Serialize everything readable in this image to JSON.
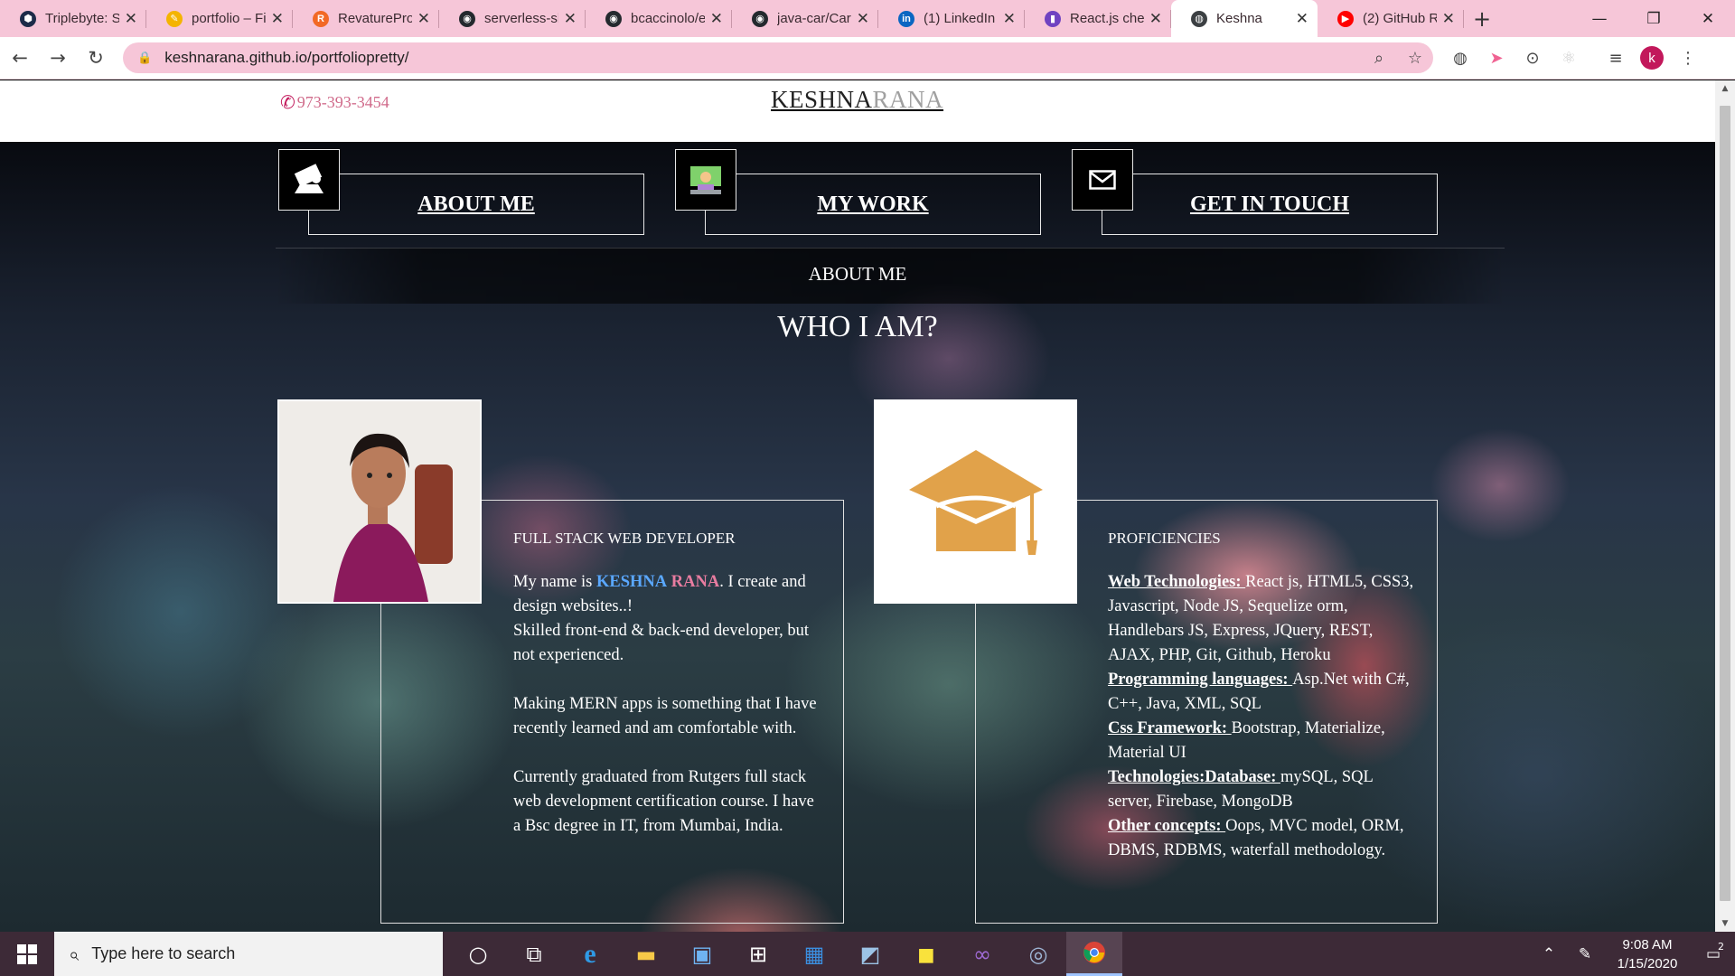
{
  "browser": {
    "tabs": [
      {
        "title": "Triplebyte: S",
        "fav_color": "#1d2b49",
        "fav_glyph": "⬢",
        "active": false
      },
      {
        "title": "portfolio – Fi",
        "fav_color": "#f4b400",
        "fav_glyph": "✎",
        "active": false
      },
      {
        "title": "RevaturePro",
        "fav_color": "#f26925",
        "fav_glyph": "R",
        "active": false
      },
      {
        "title": "serverless-sh",
        "fav_color": "#24292e",
        "fav_glyph": "◉",
        "active": false
      },
      {
        "title": "bcaccinolo/e",
        "fav_color": "#24292e",
        "fav_glyph": "◉",
        "active": false
      },
      {
        "title": "java-car/Car",
        "fav_color": "#24292e",
        "fav_glyph": "◉",
        "active": false
      },
      {
        "title": "(1) LinkedIn",
        "fav_color": "#0a66c2",
        "fav_glyph": "in",
        "active": false
      },
      {
        "title": "React.js chea",
        "fav_color": "#6f42c1",
        "fav_glyph": "▮",
        "active": false
      },
      {
        "title": "Keshna",
        "fav_color": "#3c4043",
        "fav_glyph": "◍",
        "active": true
      },
      {
        "title": "(2) GitHub R",
        "fav_color": "#ff0000",
        "fav_glyph": "▶",
        "active": false
      }
    ],
    "close_glyph": "✕",
    "new_tab_glyph": "+",
    "window_controls": {
      "minimize": "—",
      "maximize": "❐",
      "close": "✕"
    },
    "nav": {
      "back": "←",
      "forward": "→",
      "reload": "↻"
    },
    "url": "keshnarana.github.io/portfoliopretty/",
    "profile_initial": "k"
  },
  "page": {
    "phone": "973-393-3454",
    "title_part1": "KESHNA",
    "title_part2": "RANA",
    "nav": [
      {
        "label": "ABOUT ME",
        "icon": "laptop-person-icon"
      },
      {
        "label": "MY WORK",
        "icon": "coder-icon"
      },
      {
        "label": "GET IN TOUCH",
        "icon": "envelope-icon"
      }
    ],
    "section_title": "ABOUT ME",
    "section_heading": "WHO I AM?",
    "about": {
      "heading": "FULL STACK WEB DEVELOPER",
      "intro_prefix": "My name is ",
      "name_first": "KESHNA",
      "name_last": "RANA",
      "intro_suffix": ". I create and design websites..!",
      "line2": "Skilled front-end & back-end developer, but not experienced.",
      "para2": "Making MERN apps is something that I have recently learned and am comfortable with.",
      "para3": "Currently graduated from Rutgers full stack web development certification course. I have a Bsc degree in IT, from Mumbai, India."
    },
    "proficiencies": {
      "heading": "PROFICIENCIES",
      "items": [
        {
          "label": "Web Technologies: ",
          "text": "React js, HTML5, CSS3, Javascript, Node JS, Sequelize orm, Handlebars JS, Express, JQuery, REST, AJAX, PHP, Git, Github, Heroku"
        },
        {
          "label": "Programming languages: ",
          "text": "Asp.Net with C#, C++, Java, XML, SQL"
        },
        {
          "label": "Css Framework: ",
          "text": "Bootstrap, Materialize, Material UI"
        },
        {
          "label": "Technologies:Database: ",
          "text": "mySQL, SQL server, Firebase, MongoDB"
        },
        {
          "label": "Other concepts: ",
          "text": "Oops, MVC model, ORM, DBMS, RDBMS, waterfall methodology."
        }
      ]
    },
    "colors": {
      "accent_pink": "#d06a8a",
      "cap_color": "#e1a24a",
      "name_blue": "#5aa8ff",
      "name_pink": "#e87ca0"
    }
  },
  "taskbar": {
    "search_placeholder": "Type here to search",
    "time": "9:08 AM",
    "date": "1/15/2020",
    "notification_count": "2"
  }
}
